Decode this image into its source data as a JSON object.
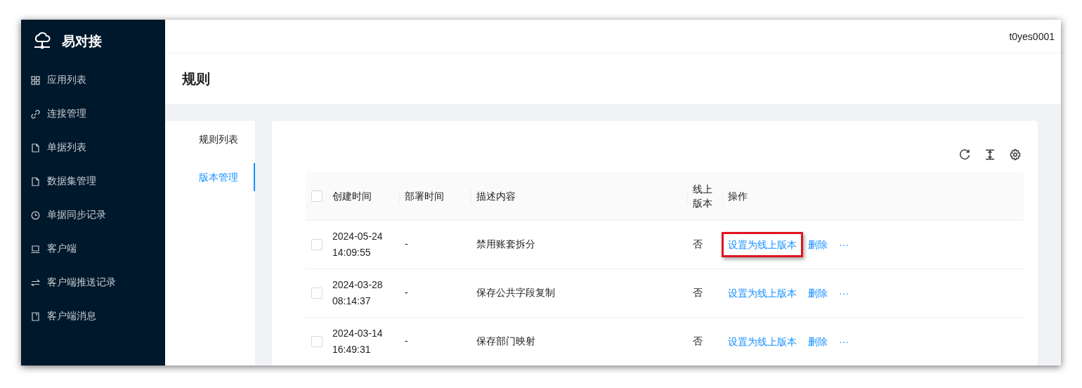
{
  "app": {
    "name": "易对接"
  },
  "sidebar": {
    "items": [
      {
        "label": "应用列表",
        "selected": false
      },
      {
        "label": "连接管理",
        "selected": false
      },
      {
        "label": "单据列表",
        "selected": false
      },
      {
        "label": "数据集管理",
        "selected": false
      },
      {
        "label": "单据同步记录",
        "selected": false
      },
      {
        "label": "客户端",
        "selected": false
      },
      {
        "label": "客户端推送记录",
        "selected": false
      },
      {
        "label": "客户端消息",
        "selected": false
      }
    ]
  },
  "header": {
    "user": "t0yes0001"
  },
  "page": {
    "title": "规则"
  },
  "sub_menu": [
    {
      "label": "规则列表",
      "selected": false
    },
    {
      "label": "版本管理",
      "selected": true
    }
  ],
  "table": {
    "all_checked": false,
    "columns": [
      "创建时间",
      "部署时间",
      "描述内容",
      "线上版本",
      "操作"
    ],
    "rows": [
      {
        "checked": false,
        "created": "2024-05-24 14:09:55",
        "deployed": "-",
        "description": "禁用账套拆分",
        "online": "否",
        "actions": [
          {
            "label": "设置为线上版本",
            "highlighted": true
          },
          {
            "label": "删除",
            "highlighted": false
          },
          {
            "label": "···",
            "highlighted": false
          }
        ]
      },
      {
        "checked": false,
        "created": "2024-03-28 08:14:37",
        "deployed": "-",
        "description": "保存公共字段复制",
        "online": "否",
        "actions": [
          {
            "label": "设置为线上版本",
            "highlighted": false
          },
          {
            "label": "删除",
            "highlighted": false
          },
          {
            "label": "···",
            "highlighted": false
          }
        ]
      },
      {
        "checked": false,
        "created": "2024-03-14 16:49:31",
        "deployed": "-",
        "description": "保存部门映射",
        "online": "否",
        "actions": [
          {
            "label": "设置为线上版本",
            "highlighted": false
          },
          {
            "label": "删除",
            "highlighted": false
          },
          {
            "label": "···",
            "highlighted": false
          }
        ]
      }
    ]
  }
}
